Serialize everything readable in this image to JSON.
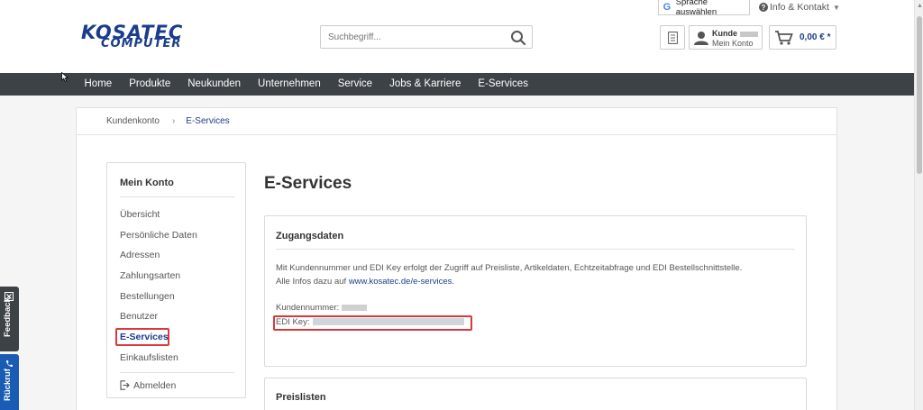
{
  "header": {
    "logo_top": "KOSATEC",
    "logo_bottom": "COMPUTER",
    "lang_button": "Sprache auswählen",
    "info_link": "Info & Kontakt",
    "search_placeholder": "Suchbegriff...",
    "account_line1": "Kunde",
    "account_line2": "Mein Konto",
    "cart_total": "0,00 € *"
  },
  "nav": {
    "items": [
      "Home",
      "Produkte",
      "Neukunden",
      "Unternehmen",
      "Service",
      "Jobs & Karriere",
      "E-Services"
    ]
  },
  "breadcrumb": {
    "items": [
      "Kundenkonto",
      "E-Services"
    ]
  },
  "sidebar": {
    "title": "Mein Konto",
    "items": [
      "Übersicht",
      "Persönliche Daten",
      "Adressen",
      "Zahlungsarten",
      "Bestellungen",
      "Benutzer",
      "E-Services",
      "Einkaufslisten"
    ],
    "logout": "Abmelden"
  },
  "main": {
    "title": "E-Services",
    "panel": {
      "title": "Zugangsdaten",
      "text1": "Mit Kundennummer und EDI Key erfolgt der Zugriff auf Preisliste, Artikeldaten, Echtzeitabfrage und EDI Bestellschnittstelle.",
      "text2_prefix": "Alle Infos dazu auf",
      "text2_link": "www.kosatec.de/e-services.",
      "customer_number_label": "Kundennummer:",
      "edi_key_label": "EDI Key:"
    },
    "panel2_title": "Preislisten"
  },
  "side_tabs": {
    "feedback": "Feedback",
    "rueckruf": "Rückruf"
  },
  "colors": {
    "brand": "#1a3c8c",
    "nav_bg": "#3d4247",
    "highlight": "#d9393c",
    "rueckruf_bg": "#1a5cb4"
  }
}
